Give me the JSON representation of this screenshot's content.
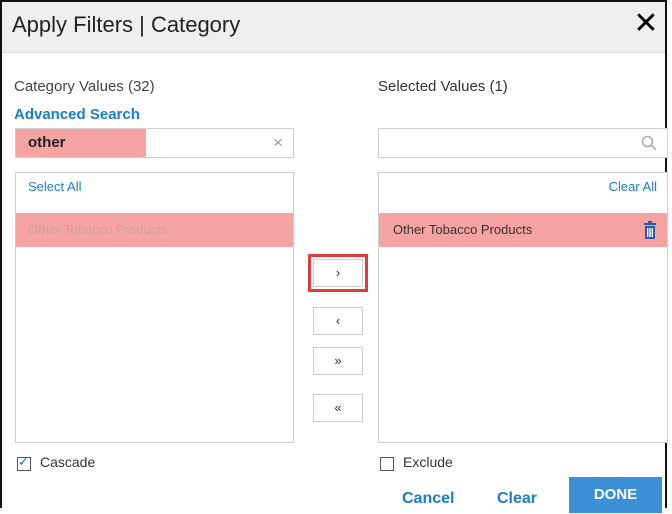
{
  "dialog": {
    "title": "Apply Filters | Category",
    "close_label": "✕"
  },
  "left_panel": {
    "heading": "Category Values (32)",
    "advanced_search_label": "Advanced Search",
    "search_value": "other",
    "clear_label": "×",
    "select_all_label": "Select All",
    "items": [
      {
        "label": "Other Tobacco Products",
        "highlighted": true
      }
    ]
  },
  "right_panel": {
    "heading": "Selected Values (1)",
    "search_placeholder": "",
    "clear_all_label": "Clear All",
    "items": [
      {
        "label": "Other Tobacco Products",
        "icon": "trash-icon"
      }
    ]
  },
  "move_buttons": {
    "add": "›",
    "remove": "‹",
    "add_all": "»",
    "remove_all": "«"
  },
  "options": {
    "cascade_label": "Cascade",
    "cascade_checked": true,
    "exclude_label": "Exclude",
    "exclude_checked": false
  },
  "footer": {
    "cancel_label": "Cancel",
    "clear_label": "Clear",
    "done_label": "DONE"
  },
  "colors": {
    "accent": "#1a7ec9",
    "done_button": "#3a8fd6",
    "highlight": "#f5a3a3",
    "focus_outline": "#e23b3b"
  }
}
